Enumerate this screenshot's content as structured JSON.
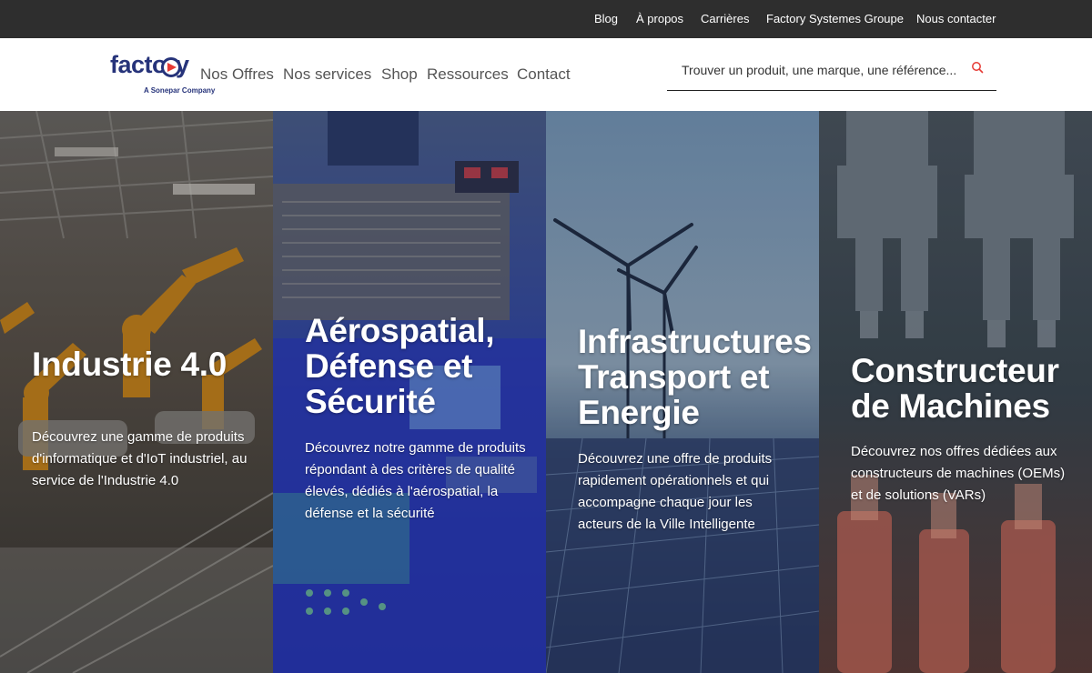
{
  "topbar": {
    "links": [
      "Blog",
      "À propos",
      "Carrières",
      "Factory Systemes Groupe",
      "Nous contacter"
    ]
  },
  "logo": {
    "word": "factory",
    "tagline": "A Sonepar Company",
    "brand_color": "#26337a",
    "accent_color": "#e63a34"
  },
  "nav": {
    "items": [
      "Nos Offres",
      "Nos services",
      "Shop",
      "Ressources",
      "Contact"
    ]
  },
  "search": {
    "placeholder": "Trouver un produit, une marque, une référence...",
    "icon": "search-icon"
  },
  "panels": [
    {
      "title_lines": [
        "Industrie 4.0"
      ],
      "description": "Découvrez une gamme de produits d'informatique et d'IoT industriel, au service de l'Industrie 4.0",
      "image": "robotic-assembly-line"
    },
    {
      "title_lines": [
        "Aérospatial,",
        "Défense et",
        "Sécurité"
      ],
      "description": "Découvrez notre gamme de produits répondant à des critères de qualité élevés, dédiés à l'aérospatial, la défense et la sécurité",
      "image": "control-panel"
    },
    {
      "title_lines": [
        "Infrastructures",
        "Transport et",
        "Energie"
      ],
      "description": "Découvrez une offre de produits rapidement opérationnels et qui accompagne chaque jour les acteurs de la Ville Intelligente",
      "image": "wind-turbines-solar-panels"
    },
    {
      "title_lines": [
        "Constructeur",
        "de Machines"
      ],
      "description": "Découvrez nos offres dédiées aux constructeurs de machines (OEMs) et de solutions (VARs)",
      "image": "bottling-machine"
    }
  ]
}
